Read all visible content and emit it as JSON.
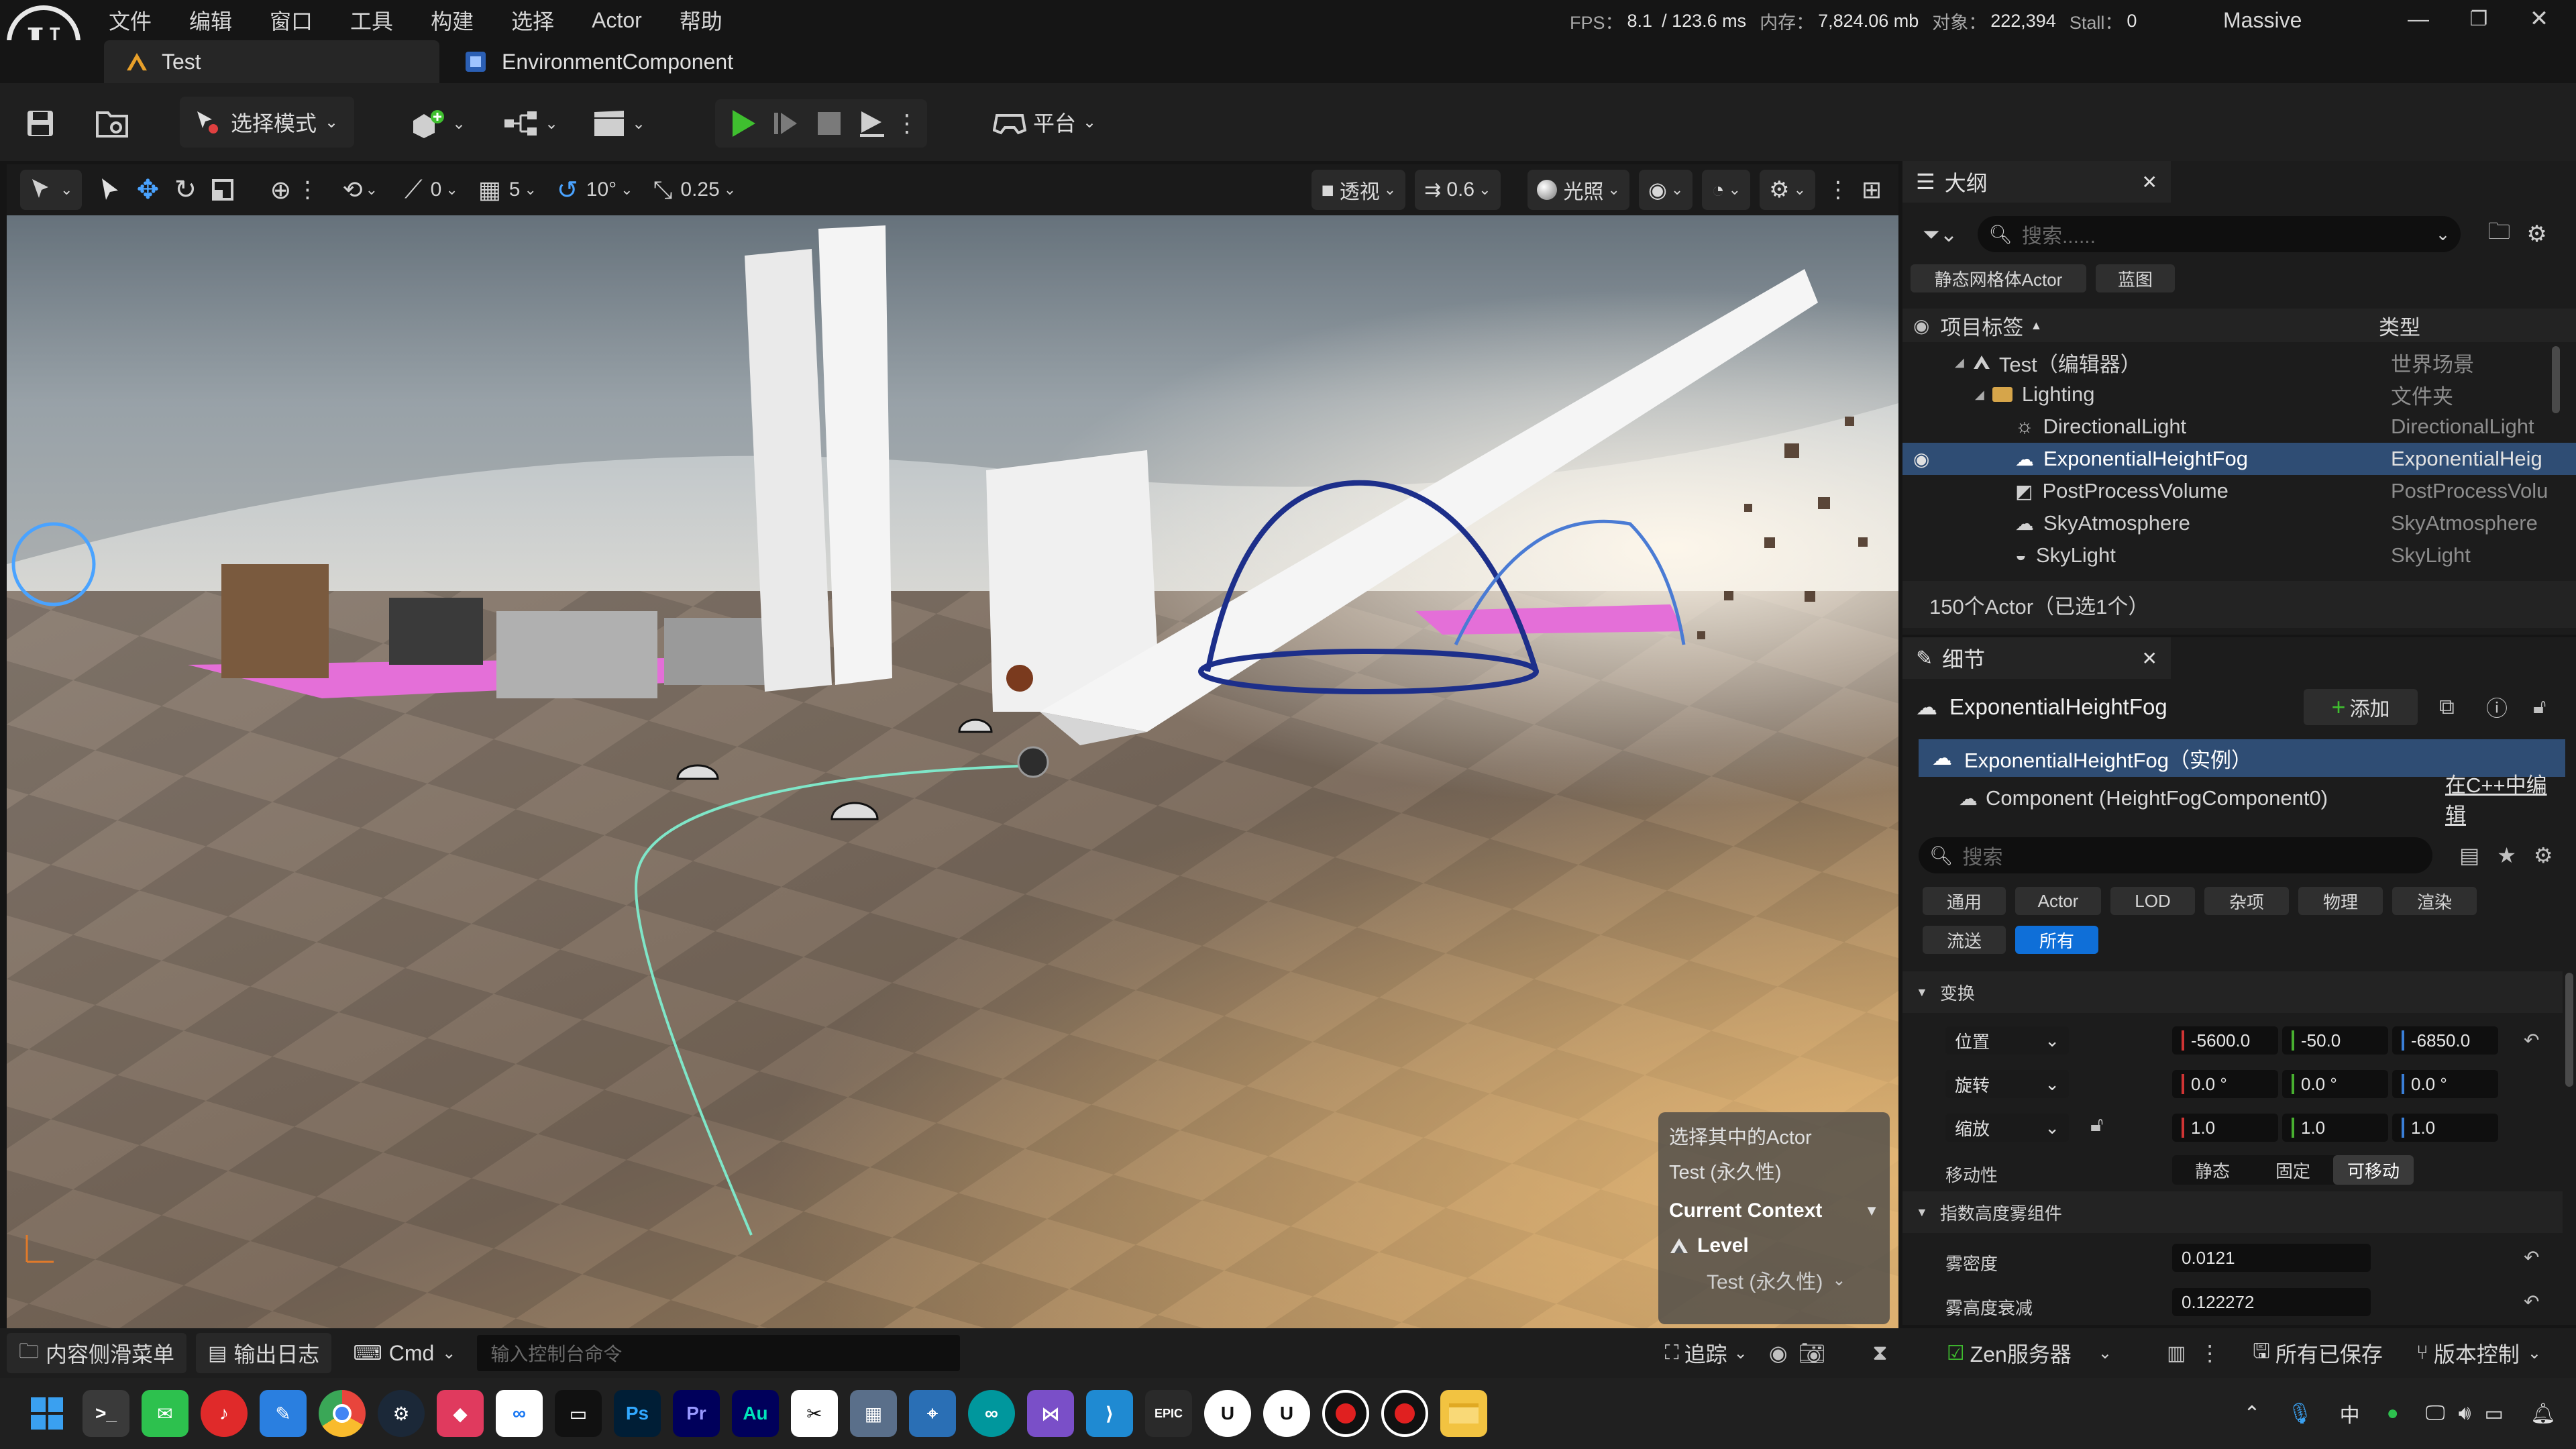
{
  "menu": [
    "文件",
    "编辑",
    "窗口",
    "工具",
    "构建",
    "选择",
    "Actor",
    "帮助"
  ],
  "stats": {
    "fps_label": "FPS：",
    "fps": "8.1",
    "frame": "/ 123.6 ms",
    "mem_label": "内存：",
    "mem": "7,824.06 mb",
    "obj_label": "对象：",
    "obj": "222,394",
    "stall_label": "Stall：",
    "stall": "0"
  },
  "project_name": "Massive",
  "tabs": {
    "level": "Test",
    "component": "EnvironmentComponent"
  },
  "toolbar": {
    "mode": "选择模式",
    "platform": "平台"
  },
  "viewport_toolbar": {
    "angle_snap": "0",
    "grid_snap": "5",
    "rot_snap": "10°",
    "scale_snap": "0.25",
    "view_mode": "透视",
    "cam_speed": "0.6",
    "lighting": "光照"
  },
  "context_popup": {
    "line1": "选择其中的Actor",
    "line2": "Test (永久性)",
    "heading": "Current Context",
    "level": "Level",
    "level_value": "Test (永久性)"
  },
  "outliner": {
    "title": "大纲",
    "search_placeholder": "搜索......",
    "filters": [
      "静态网格体Actor",
      "蓝图"
    ],
    "col_label": "项目标签",
    "col_type": "类型",
    "rows": [
      {
        "label": "Test（编辑器）",
        "type": "世界场景"
      },
      {
        "label": "Lighting",
        "type": "文件夹"
      },
      {
        "label": "DirectionalLight",
        "type": "DirectionalLight"
      },
      {
        "label": "ExponentialHeightFog",
        "type": "ExponentialHeig"
      },
      {
        "label": "PostProcessVolume",
        "type": "PostProcessVolu"
      },
      {
        "label": "SkyAtmosphere",
        "type": "SkyAtmosphere"
      },
      {
        "label": "SkyLight",
        "type": "SkyLight"
      }
    ],
    "footer": "150个Actor（已选1个）"
  },
  "details": {
    "title": "细节",
    "actor_name": "ExponentialHeightFog",
    "add_label": "添加",
    "instance": "ExponentialHeightFog（实例）",
    "component": "Component (HeightFogComponent0)",
    "edit_cpp": "在C++中编辑",
    "search_placeholder": "搜索",
    "filters": [
      "通用",
      "Actor",
      "LOD",
      "杂项",
      "物理",
      "渲染"
    ],
    "filters2": [
      "流送",
      "所有"
    ],
    "section_transform": "变换",
    "location_label": "位置",
    "location": [
      "-5600.0",
      "-50.0",
      "-6850.0"
    ],
    "rotation_label": "旋转",
    "rotation": [
      "0.0 °",
      "0.0 °",
      "0.0 °"
    ],
    "scale_label": "缩放",
    "scale": [
      "1.0",
      "1.0",
      "1.0"
    ],
    "mobility_label": "移动性",
    "mobility": [
      "静态",
      "固定",
      "可移动"
    ],
    "section_fog": "指数高度雾组件",
    "fog_density_label": "雾密度",
    "fog_density": "0.0121",
    "fog_falloff_label": "雾高度衰减",
    "fog_falloff": "0.122272"
  },
  "statusbar": {
    "content_drawer": "内容侧滑菜单",
    "output_log": "输出日志",
    "cmd": "Cmd",
    "console_placeholder": "输入控制台命令",
    "trace": "追踪",
    "zen": "Zen服务器",
    "saved": "所有已保存",
    "source_control": "版本控制"
  },
  "taskbar": {
    "ime": "中"
  },
  "colors": {
    "accent": "#0f6fd8",
    "selection": "#2f4d74",
    "play": "#3fbf2f"
  }
}
